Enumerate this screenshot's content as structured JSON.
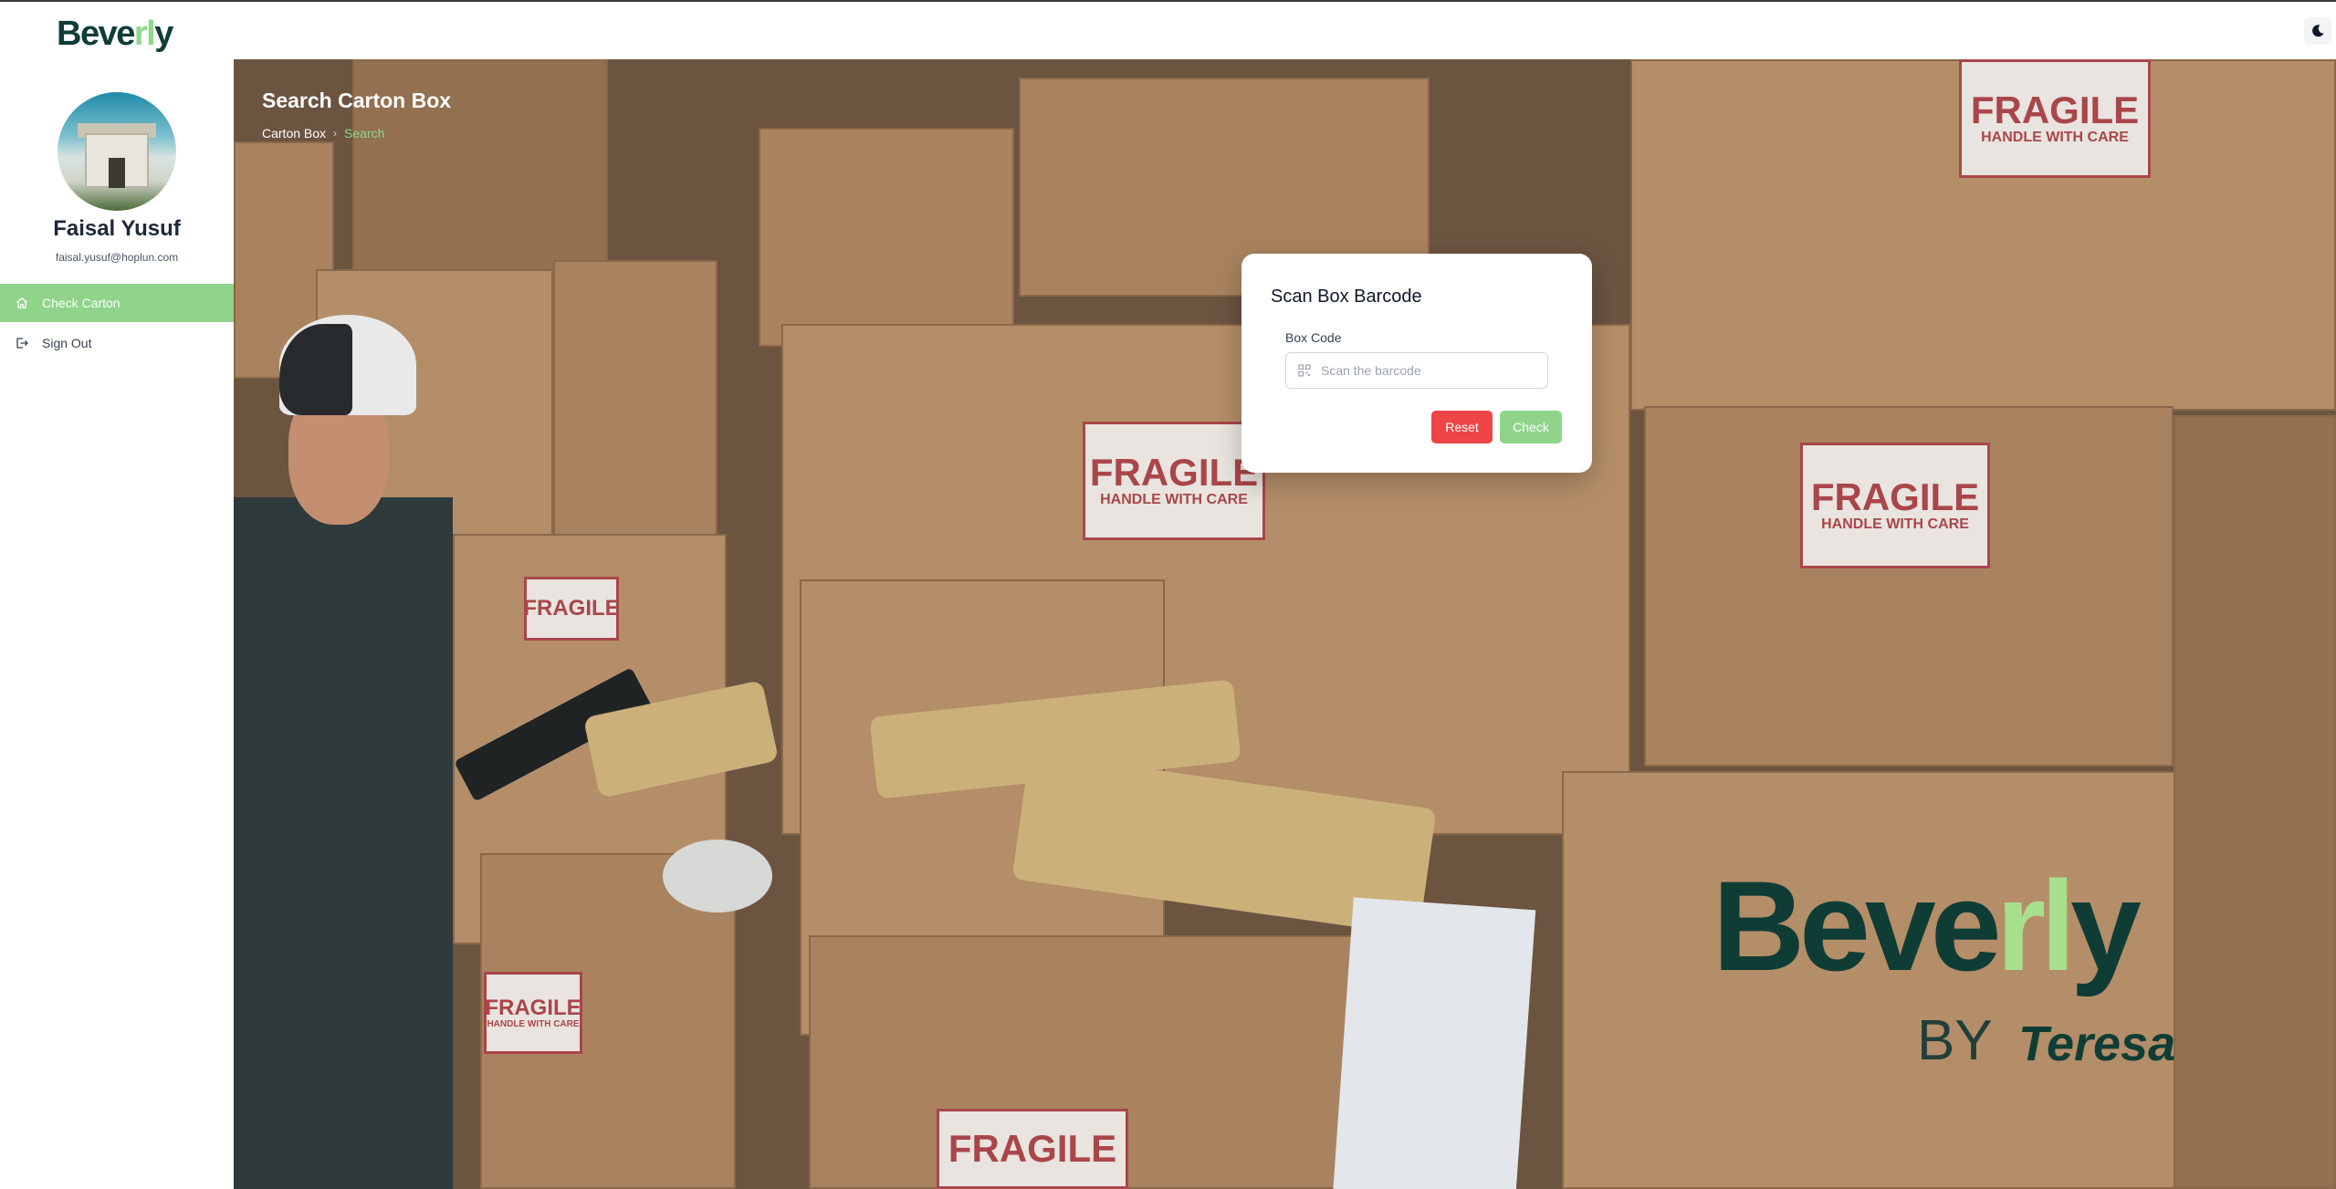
{
  "app": {
    "logo_text_pre": "Beve",
    "logo_text_accent": "rl",
    "logo_text_post": "y"
  },
  "header": {
    "theme_toggle_icon": "moon-icon"
  },
  "sidebar": {
    "user_name": "Faisal Yusuf",
    "user_email": "faisal.yusuf@hoplun.com",
    "items": [
      {
        "label": "Check Carton",
        "icon": "home-icon",
        "active": true
      },
      {
        "label": "Sign Out",
        "icon": "sign-out-icon",
        "active": false
      }
    ]
  },
  "main": {
    "title": "Search Carton Box",
    "breadcrumb": [
      "Carton Box",
      "Search"
    ],
    "background_labels": {
      "fragile": "FRAGILE",
      "handle": "HANDLE WITH CARE"
    },
    "brand": {
      "word_pre": "Beve",
      "word_accent": "rl",
      "word_post": "y",
      "by": "BY",
      "partner": "Teresa"
    }
  },
  "modal": {
    "title": "Scan Box Barcode",
    "field_label": "Box Code",
    "field_placeholder": "Scan the barcode",
    "field_value": "",
    "reset_label": "Reset",
    "check_label": "Check"
  },
  "colors": {
    "brand_dark": "#0f3d36",
    "brand_green": "#8fd48a",
    "danger": "#ef4446"
  }
}
